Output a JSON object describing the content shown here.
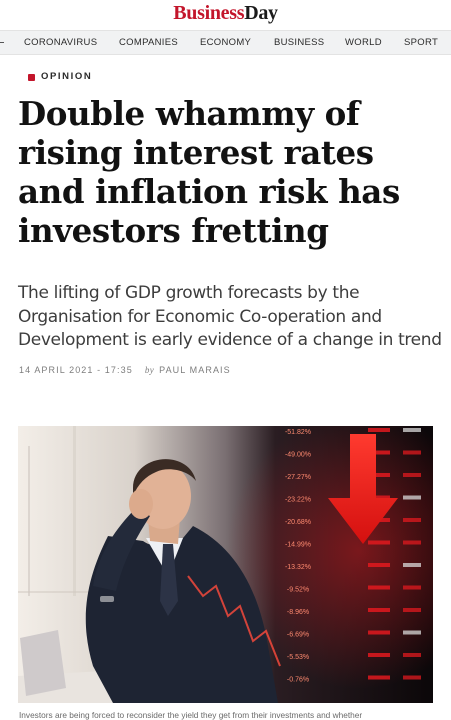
{
  "masthead": {
    "logo_part1": "Business",
    "logo_part2": "Day"
  },
  "nav": [
    "CORONAVIRUS",
    "COMPANIES",
    "ECONOMY",
    "BUSINESS",
    "WORLD",
    "SPORT"
  ],
  "article": {
    "section": "OPINION",
    "headline": "Double whammy of rising interest rates and inflation risk has investors fretting",
    "standfirst": "The lifting of GDP growth forecasts by the Organisation for Economic Co-operation and Development is early evidence of a change in trend",
    "date": "14 APRIL 2021 - 17:35",
    "by": "by",
    "author": "PAUL MARAIS",
    "caption": "Investors are being forced to reconsider the yield they get from their investments and whether"
  },
  "photo": {
    "ticker_values": [
      "-51.82%",
      "-49.00%",
      "-27.27%",
      "-23.22%",
      "-20.68%",
      "-14.99%",
      "-13.32%",
      "-9.52%",
      "-8.96%",
      "-6.69%",
      "-5.53%",
      "-0.76%"
    ],
    "accent_color": "#e0191f"
  },
  "colors": {
    "brand_red": "#c3152b"
  }
}
